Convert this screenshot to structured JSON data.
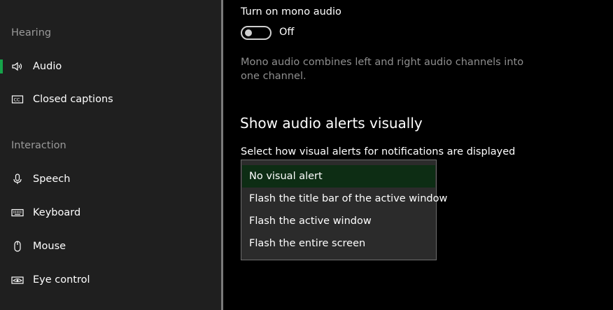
{
  "sidebar": {
    "sections": [
      {
        "heading": "Hearing",
        "items": [
          {
            "label": "Audio",
            "icon": "speaker-icon",
            "selected": true
          },
          {
            "label": "Closed captions",
            "icon": "closed-captions-icon",
            "selected": false
          }
        ]
      },
      {
        "heading": "Interaction",
        "items": [
          {
            "label": "Speech",
            "icon": "microphone-icon",
            "selected": false
          },
          {
            "label": "Keyboard",
            "icon": "keyboard-icon",
            "selected": false
          },
          {
            "label": "Mouse",
            "icon": "mouse-icon",
            "selected": false
          },
          {
            "label": "Eye control",
            "icon": "eye-icon",
            "selected": false
          }
        ]
      }
    ]
  },
  "mono_audio": {
    "title": "Turn on mono audio",
    "toggle_state": "Off",
    "toggle_on": false,
    "description": "Mono audio combines left and right audio channels into one channel."
  },
  "visual_alerts": {
    "heading": "Show audio alerts visually",
    "label": "Select how visual alerts for notifications are displayed",
    "options": [
      {
        "label": "No visual alert",
        "selected": true
      },
      {
        "label": "Flash the title bar of the active window",
        "selected": false
      },
      {
        "label": "Flash the active window",
        "selected": false
      },
      {
        "label": "Flash the entire screen",
        "selected": false
      }
    ]
  },
  "colors": {
    "accent": "#16a34a",
    "sidebar_bg": "#1f1f1f",
    "content_bg": "#000000",
    "selected_option_bg": "#0d2d14"
  }
}
